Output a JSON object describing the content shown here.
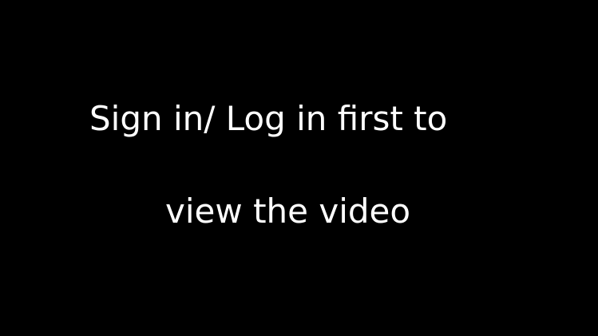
{
  "video_overlay": {
    "message_line_1": "Sign in/ Log in first to",
    "message_line_2": "view the video",
    "background_color": "#000000",
    "text_color": "#ffffff"
  }
}
